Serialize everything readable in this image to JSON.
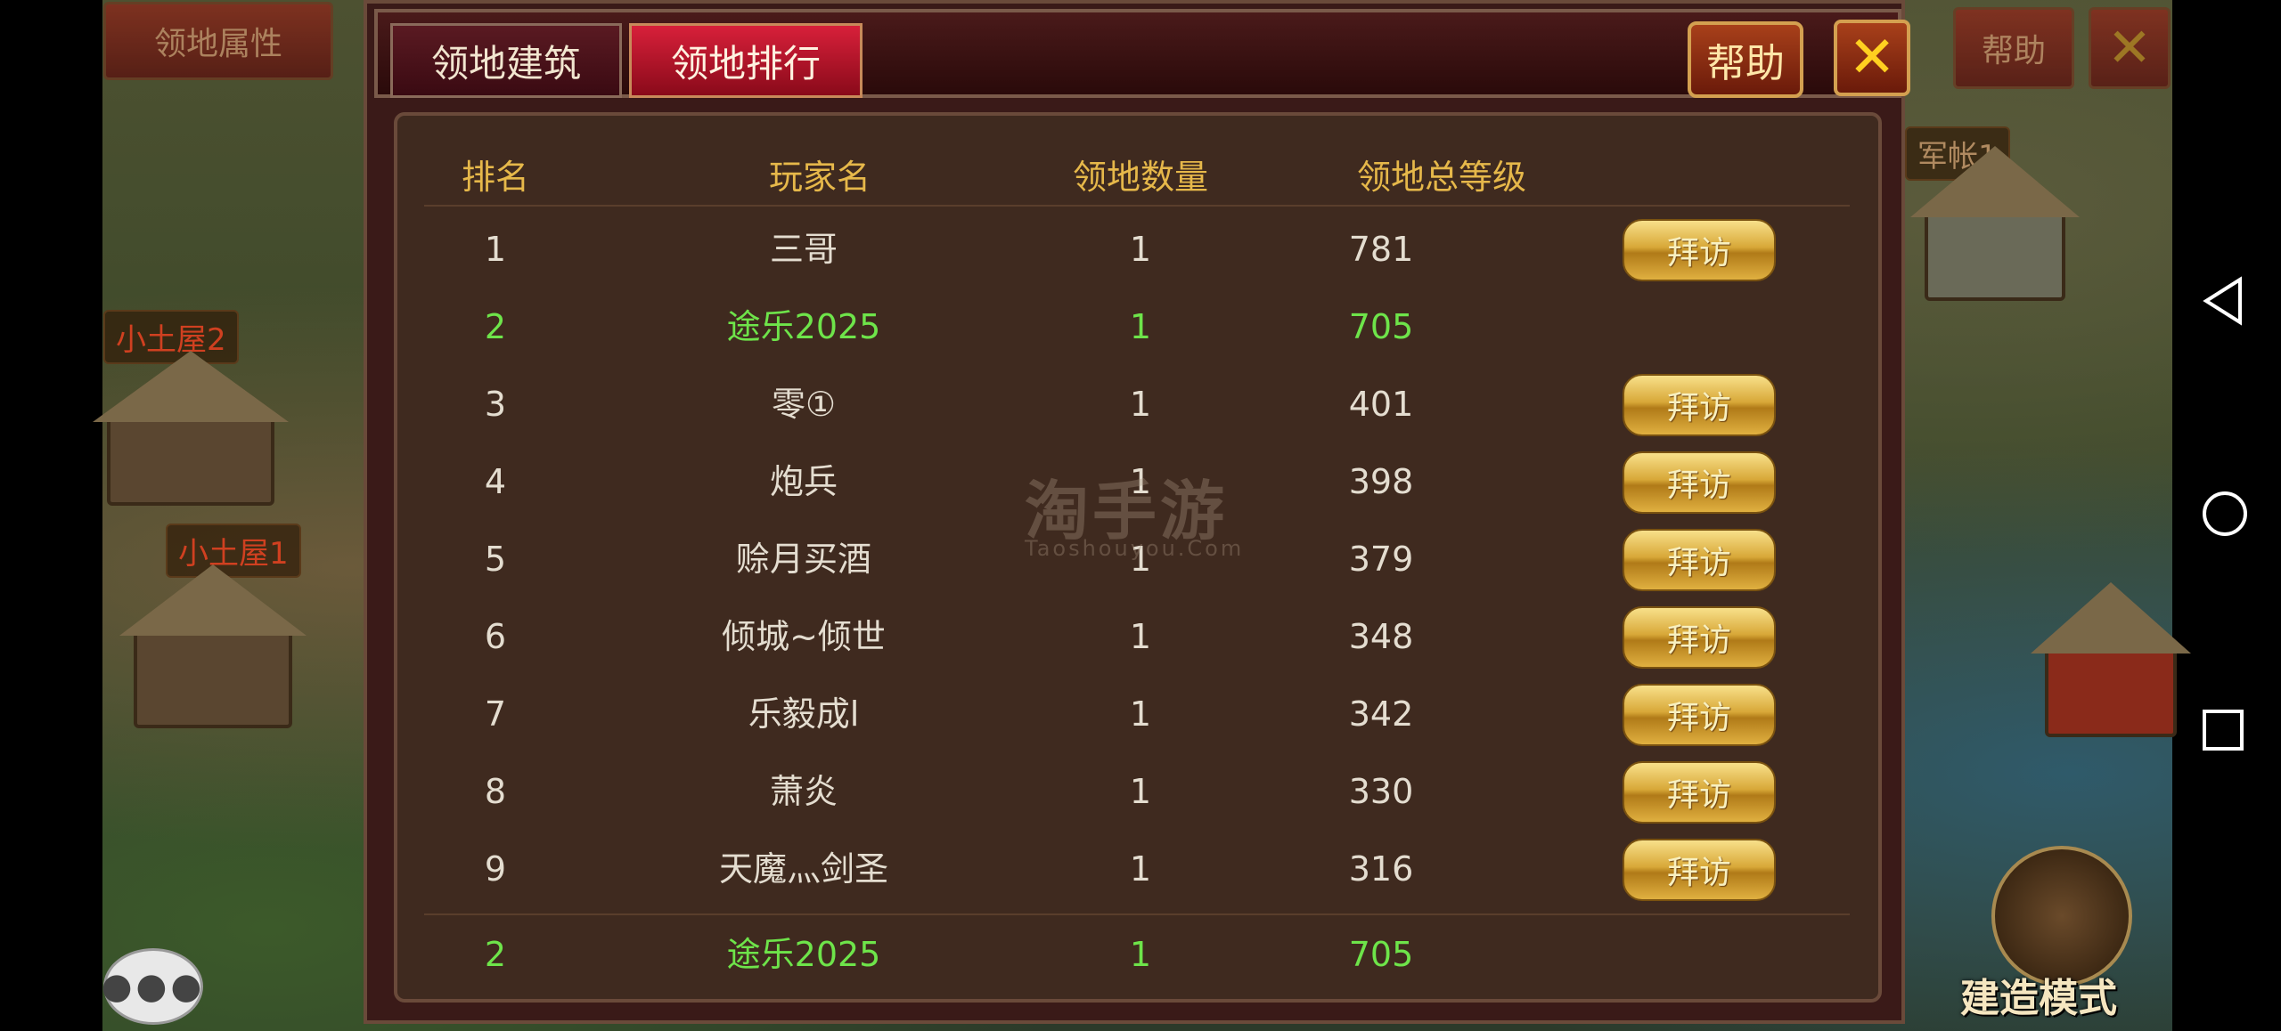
{
  "background": {
    "left_button": "领地属性",
    "help_button": "帮助",
    "close_icon": "close-x-icon",
    "labels": [
      "小土屋2",
      "小土屋1",
      "军帐1"
    ],
    "build_mode": "建造模式",
    "chat_icon": "chat-bubble-icon"
  },
  "dialog": {
    "tabs": [
      {
        "label": "领地建筑",
        "active": false
      },
      {
        "label": "领地排行",
        "active": true
      }
    ],
    "help_label": "帮助",
    "close_label": "✕",
    "table": {
      "headers": [
        "排名",
        "玩家名",
        "领地数量",
        "领地总等级"
      ],
      "rows": [
        {
          "rank": "1",
          "name": "三哥",
          "count": "1",
          "level": "781",
          "visit": "拜访"
        },
        {
          "rank": "2",
          "name": "途乐2025",
          "count": "1",
          "level": "705",
          "visit": "",
          "self": true
        },
        {
          "rank": "3",
          "name": "零①",
          "count": "1",
          "level": "401",
          "visit": "拜访"
        },
        {
          "rank": "4",
          "name": "炮兵",
          "count": "1",
          "level": "398",
          "visit": "拜访"
        },
        {
          "rank": "5",
          "name": "赊月买酒",
          "count": "1",
          "level": "379",
          "visit": "拜访"
        },
        {
          "rank": "6",
          "name": "倾城~倾世",
          "count": "1",
          "level": "348",
          "visit": "拜访"
        },
        {
          "rank": "7",
          "name": "乐毅成l",
          "count": "1",
          "level": "342",
          "visit": "拜访"
        },
        {
          "rank": "8",
          "name": "萧炎",
          "count": "1",
          "level": "330",
          "visit": "拜访"
        },
        {
          "rank": "9",
          "name": "天魔灬剑圣",
          "count": "1",
          "level": "316",
          "visit": "拜访"
        }
      ],
      "self_row": {
        "rank": "2",
        "name": "途乐2025",
        "count": "1",
        "level": "705"
      }
    }
  },
  "watermark": {
    "main": "淘手游",
    "sub": "Taoshouyou.Com"
  },
  "system_nav": {
    "back_icon": "back-triangle-icon",
    "home_icon": "home-circle-icon",
    "recent_icon": "recent-square-icon"
  }
}
